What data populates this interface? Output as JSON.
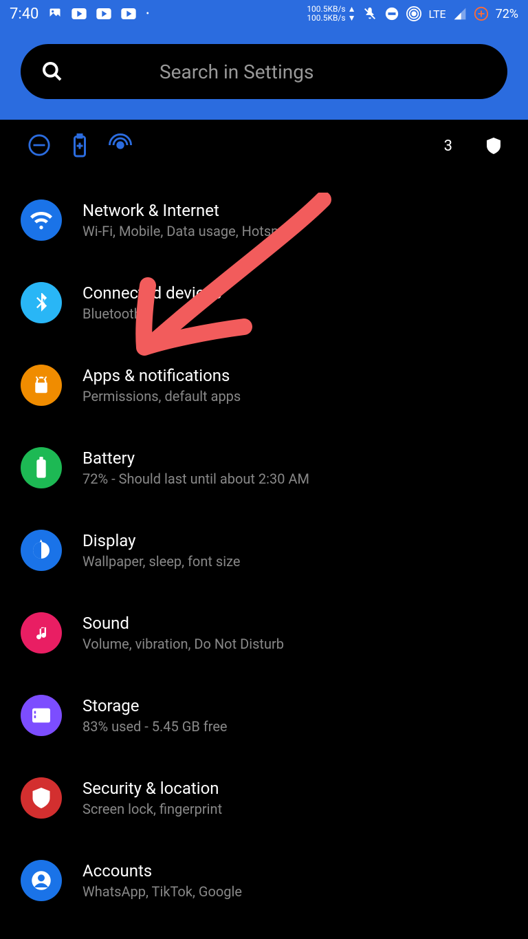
{
  "statusBar": {
    "time": "7:40",
    "netUp": "100.5KB/s ▲",
    "netDown": "100.5KB/s ▼",
    "lte": "LTE",
    "battery": "72%"
  },
  "search": {
    "placeholder": "Search in Settings"
  },
  "suggestions": {
    "count": "3"
  },
  "items": [
    {
      "title": "Network & Internet",
      "subtitle": "Wi-Fi, Mobile, Data usage, Hotspot",
      "color": "#1a73e8"
    },
    {
      "title": "Connected devices",
      "subtitle": "Bluetooth",
      "color": "#29b6f6"
    },
    {
      "title": "Apps & notifications",
      "subtitle": "Permissions, default apps",
      "color": "#f08c00"
    },
    {
      "title": "Battery",
      "subtitle": "72% - Should last until about 2:30 AM",
      "color": "#1db954"
    },
    {
      "title": "Display",
      "subtitle": "Wallpaper, sleep, font size",
      "color": "#1a73e8"
    },
    {
      "title": "Sound",
      "subtitle": "Volume, vibration, Do Not Disturb",
      "color": "#e91e63"
    },
    {
      "title": "Storage",
      "subtitle": "83% used - 5.45 GB free",
      "color": "#7c4dff"
    },
    {
      "title": "Security & location",
      "subtitle": "Screen lock, fingerprint",
      "color": "#d32f2f"
    },
    {
      "title": "Accounts",
      "subtitle": "WhatsApp, TikTok, Google",
      "color": "#1a73e8"
    }
  ]
}
